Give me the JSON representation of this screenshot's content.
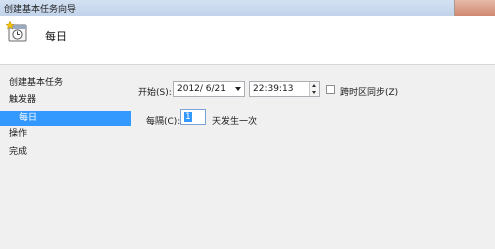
{
  "window": {
    "title": "创建基本任务向导"
  },
  "header": {
    "title": "每日",
    "icon": "task-clock-icon"
  },
  "sidebar": {
    "items": [
      {
        "label": "创建基本任务",
        "selected": false
      },
      {
        "label": "触发器",
        "selected": false
      },
      {
        "label": "每日",
        "selected": true
      },
      {
        "label": "操作",
        "selected": false
      },
      {
        "label": "完成",
        "selected": false
      }
    ]
  },
  "start": {
    "label": "开始(S):",
    "date_value": "2012/  6/21",
    "time_value": "22:39:13"
  },
  "sync": {
    "label": "跨时区同步(Z)",
    "checked": false
  },
  "recur": {
    "label": "每隔(C):",
    "value": "1",
    "suffix": "天发生一次"
  },
  "colors": {
    "selection": "#3399ff",
    "header_bg": "#ffffff",
    "body_bg": "#f0f0f0"
  }
}
